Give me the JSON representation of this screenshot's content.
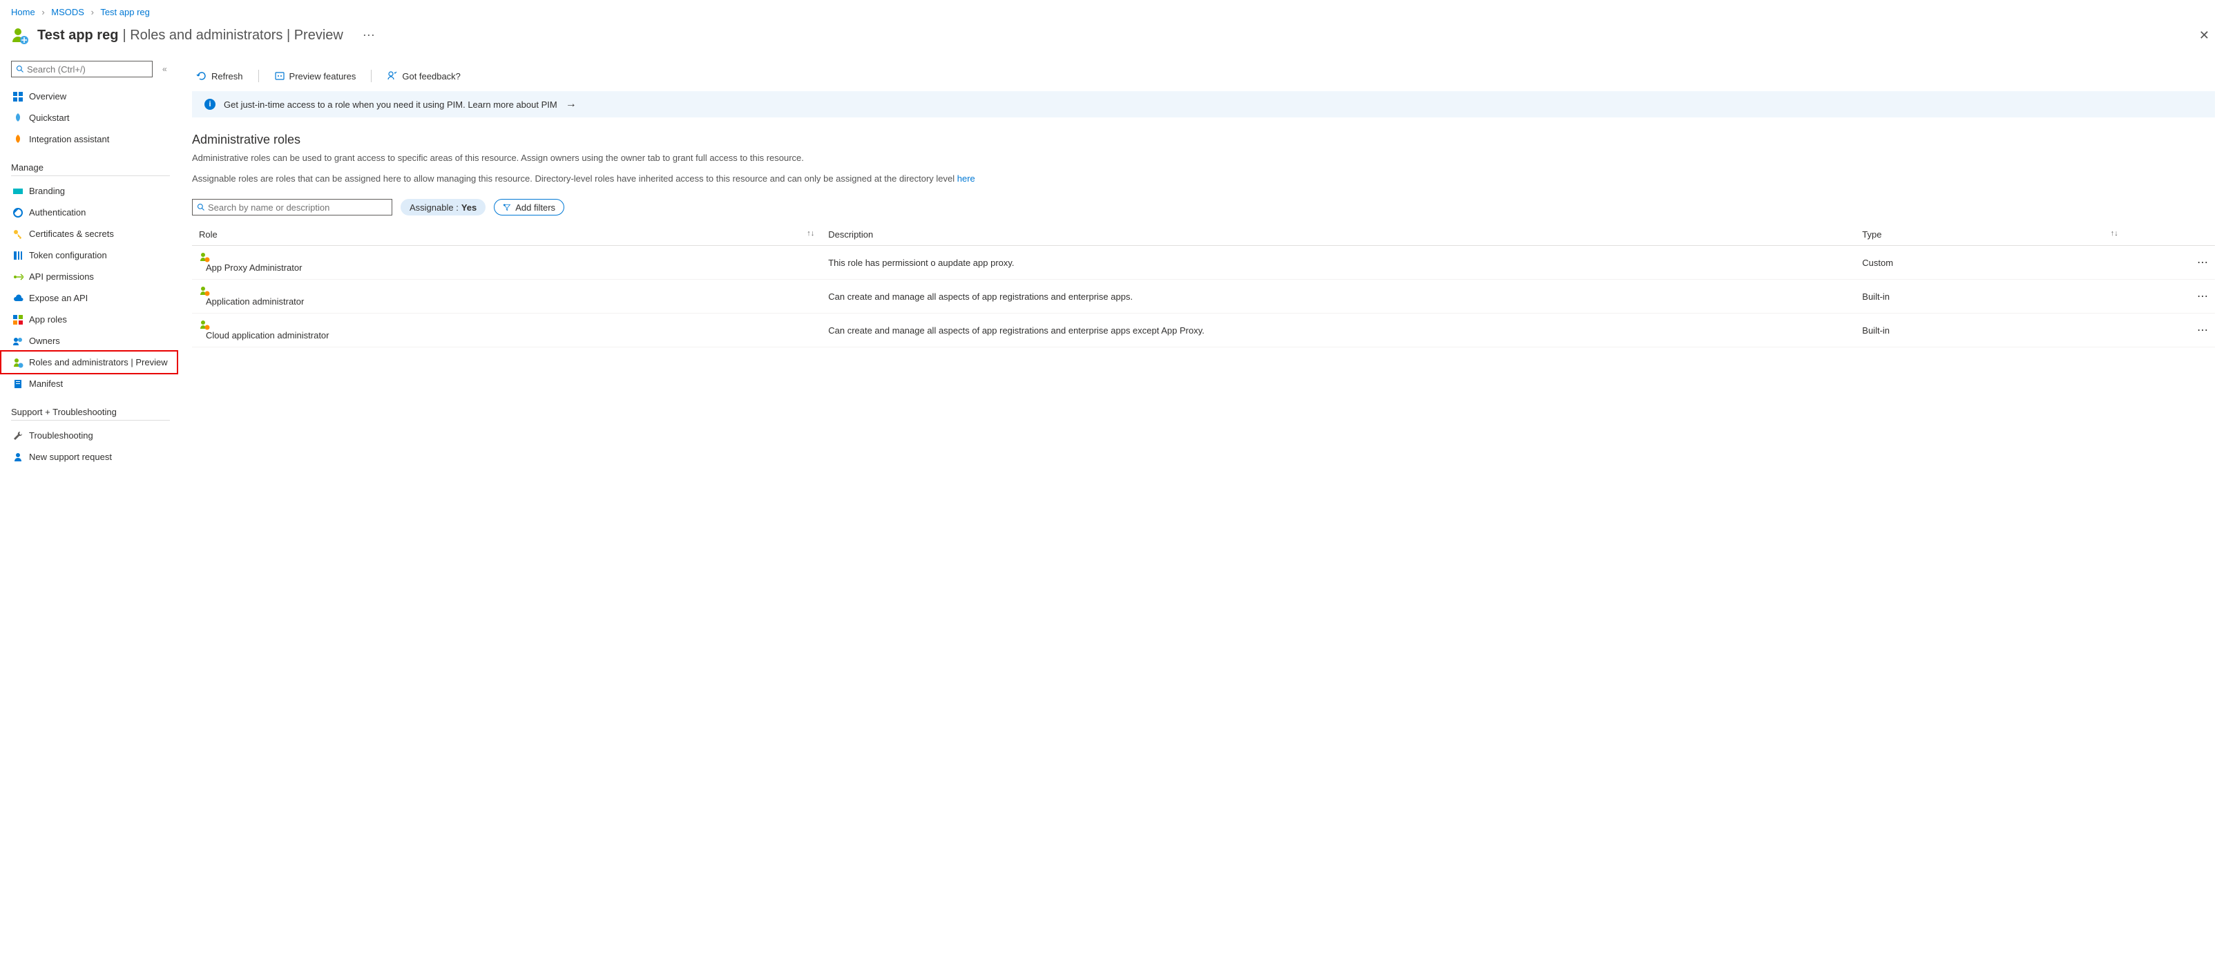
{
  "breadcrumb": {
    "home": "Home",
    "org": "MSODS",
    "app": "Test app reg"
  },
  "title": {
    "main": "Test app reg",
    "sub": "| Roles and administrators | Preview"
  },
  "sidebar": {
    "search_placeholder": "Search (Ctrl+/)",
    "items_top": [
      {
        "label": "Overview",
        "icon": "grid"
      },
      {
        "label": "Quickstart",
        "icon": "rocket-blue"
      },
      {
        "label": "Integration assistant",
        "icon": "rocket-orange"
      }
    ],
    "section_manage": "Manage",
    "items_manage": [
      {
        "label": "Branding",
        "icon": "brand"
      },
      {
        "label": "Authentication",
        "icon": "auth"
      },
      {
        "label": "Certificates & secrets",
        "icon": "key"
      },
      {
        "label": "Token configuration",
        "icon": "token"
      },
      {
        "label": "API permissions",
        "icon": "api-perm"
      },
      {
        "label": "Expose an API",
        "icon": "cloud"
      },
      {
        "label": "App roles",
        "icon": "app-roles"
      },
      {
        "label": "Owners",
        "icon": "owners"
      },
      {
        "label": "Roles and administrators | Preview",
        "icon": "roles",
        "highlighted": true
      },
      {
        "label": "Manifest",
        "icon": "manifest"
      }
    ],
    "section_support": "Support + Troubleshooting",
    "items_support": [
      {
        "label": "Troubleshooting",
        "icon": "wrench"
      },
      {
        "label": "New support request",
        "icon": "support"
      }
    ]
  },
  "toolbar": {
    "refresh": "Refresh",
    "preview": "Preview features",
    "feedback": "Got feedback?"
  },
  "banner": {
    "text": "Get just-in-time access to a role when you need it using PIM. Learn more about PIM"
  },
  "section": {
    "title": "Administrative roles",
    "desc1": "Administrative roles can be used to grant access to specific areas of this resource. Assign owners using the owner tab to grant full access to this resource.",
    "desc2a": "Assignable roles are roles that can be assigned here to allow managing this resource. Directory-level roles have inherited access to this resource and can only be assigned at the directory level ",
    "desc2link": "here"
  },
  "filters": {
    "search_placeholder": "Search by name or description",
    "assignable_label": "Assignable : ",
    "assignable_value": "Yes",
    "add_filters": "Add filters"
  },
  "table": {
    "col_role": "Role",
    "col_desc": "Description",
    "col_type": "Type",
    "rows": [
      {
        "role": "App Proxy Administrator",
        "desc": "This role has permissiont o aupdate app proxy.",
        "type": "Custom"
      },
      {
        "role": "Application administrator",
        "desc": "Can create and manage all aspects of app registrations and enterprise apps.",
        "type": "Built-in"
      },
      {
        "role": "Cloud application administrator",
        "desc": "Can create and manage all aspects of app registrations and enterprise apps except App Proxy.",
        "type": "Built-in"
      }
    ]
  }
}
